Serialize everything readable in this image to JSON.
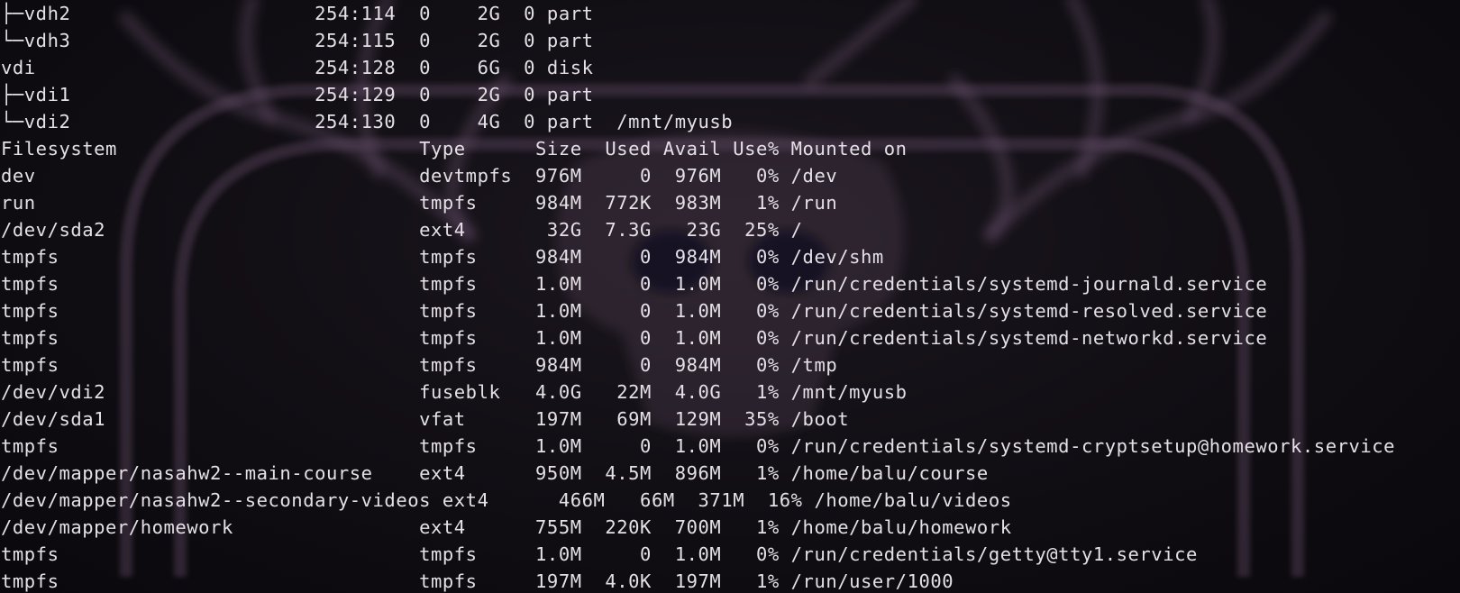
{
  "lsblk_lines": [
    "├─vdh2                     254:114  0    2G  0 part",
    "└─vdh3                     254:115  0    2G  0 part",
    "vdi                        254:128  0    6G  0 disk",
    "├─vdi1                     254:129  0    2G  0 part",
    "└─vdi2                     254:130  0    4G  0 part  /mnt/myusb"
  ],
  "df_header": "Filesystem                          Type      Size  Used Avail Use% Mounted on",
  "df_lines": [
    "dev                                 devtmpfs  976M     0  976M   0% /dev",
    "run                                 tmpfs     984M  772K  983M   1% /run",
    "/dev/sda2                           ext4       32G  7.3G   23G  25% /",
    "tmpfs                               tmpfs     984M     0  984M   0% /dev/shm",
    "tmpfs                               tmpfs     1.0M     0  1.0M   0% /run/credentials/systemd-journald.service",
    "tmpfs                               tmpfs     1.0M     0  1.0M   0% /run/credentials/systemd-resolved.service",
    "tmpfs                               tmpfs     1.0M     0  1.0M   0% /run/credentials/systemd-networkd.service",
    "tmpfs                               tmpfs     984M     0  984M   0% /tmp",
    "/dev/vdi2                           fuseblk   4.0G   22M  4.0G   1% /mnt/myusb",
    "/dev/sda1                           vfat      197M   69M  129M  35% /boot",
    "tmpfs                               tmpfs     1.0M     0  1.0M   0% /run/credentials/systemd-cryptsetup@homework.service",
    "/dev/mapper/nasahw2--main-course    ext4      950M  4.5M  896M   1% /home/balu/course",
    "/dev/mapper/nasahw2--secondary-videos ext4      466M   66M  371M  16% /home/balu/videos",
    "/dev/mapper/homework                ext4      755M  220K  700M   1% /home/balu/homework",
    "tmpfs                               tmpfs     1.0M     0  1.0M   0% /run/credentials/getty@tty1.service",
    "tmpfs                               tmpfs     197M  4.0K  197M   1% /run/user/1000"
  ],
  "colors": {
    "text": "#e4e0e6",
    "background": "#0c0a0e",
    "wallpaper_accent": "#6a5470"
  }
}
